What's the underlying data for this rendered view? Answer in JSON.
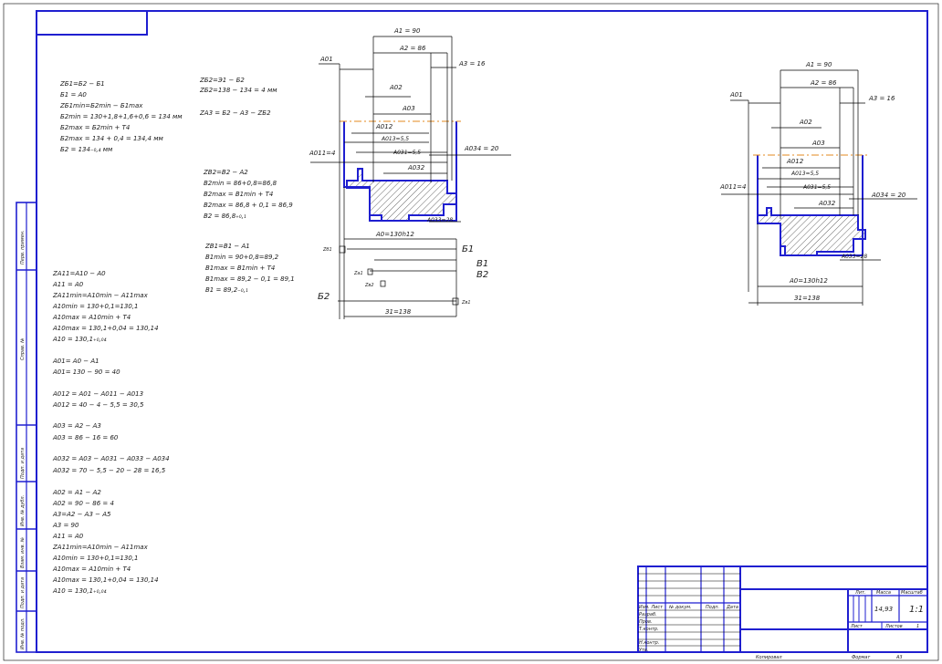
{
  "sheet": {
    "format_label": "Формат",
    "format_value": "A3",
    "copied_label": "Копировал"
  },
  "calc_left": [
    "ZБ1=Б2 − Б1",
    "Б1 = А0",
    "ZБ1min=Б2min − Б1max",
    "Б2min = 130+1,8+1,6+0,6 = 134 мм",
    "Б2max = Б2min + T4",
    "Б2max = 134 + 0,4 = 134,4 мм",
    "Б2 = 134₋₀,₄ мм"
  ],
  "calc_mid1": [
    "ZБ2=Э1 − Б2",
    "ZБ2=138 − 134 = 4 мм"
  ],
  "calc_mid2": [
    "ZА3 = Б2 − А3 − ZБ2"
  ],
  "calc_mid3": [
    "ZВ2=В2 − А2",
    "В2min = 86+0,8=86,8",
    "В2max = В1min + T4",
    "В2max = 86,8 + 0,1 = 86,9",
    "В2 = 86,8₊₀,₁"
  ],
  "calc_mid4": [
    "ZВ1=В1 − А1",
    "В1min = 90+0,8=89,2",
    "В1max = В1min + T4",
    "В1max = 89,2 − 0,1 = 89,1",
    "В1 = 89,2₋₀,₁"
  ],
  "calc_a": [
    "ZА11=А10 − А0",
    "А11 = А0",
    "ZА11min=А10min − А11max",
    "А10min = 130+0,1=130,1",
    "А10max = А10min + T4",
    "А10max = 130,1+0,04 = 130,14",
    "А10 = 130,1₊₀,₀₄"
  ],
  "calc_b": [
    "А01= А0 − А1",
    "А01= 130 − 90 = 40"
  ],
  "calc_c": [
    "А012 = А01 − А011 − А013",
    "А012 = 40 − 4 − 5,5 = 30,5"
  ],
  "calc_d": [
    "А03 = А2 − А3",
    "А03 = 86 − 16 = 60"
  ],
  "calc_e": [
    "А032 = А03 − А031 − А033 − А034",
    "А032 = 70 − 5,5 − 20 − 28 = 16,5"
  ],
  "calc_f": [
    "А02 = А1 − А2",
    "А02 = 90 − 86 = 4",
    "А3=А2 − А3 − А5",
    "А3 = 90",
    "А11 = А0",
    "ZА11min=А10min − А11max",
    "А10min = 130+0,1=130,1",
    "А10max = А10min + T4",
    "А10max = 130,1+0,04 = 130,14",
    "А10 = 130,1₊₀,₀₄"
  ],
  "drawing1": {
    "dims": {
      "a1": "А1 = 90",
      "a2": "А2 = 86",
      "a3": "А3 = 16",
      "a01": "А01",
      "a02": "А02",
      "a03": "А03",
      "a012": "А012",
      "a013": "А013=5,5",
      "a031": "А031=5,5",
      "a011": "А011=4",
      "a034": "А034 = 20",
      "a032": "А032",
      "a033": "А033=28",
      "a0": "А0=130h12",
      "b1": "Б1",
      "b2": "Б2",
      "v1": "В1",
      "v2": "В2",
      "zb1": "Zб1",
      "za1": "Zа1",
      "zv2": "Zв2",
      "zv1": "Zв1",
      "e1": "З1=138"
    }
  },
  "drawing2": {
    "dims": {
      "a1": "А1 = 90",
      "a2": "А2 = 86",
      "a3": "А3 = 16",
      "a01": "А01",
      "a02": "А02",
      "a03": "А03",
      "a012": "А012",
      "a013": "А013=5,5",
      "a031": "А031=5,5",
      "a011": "А011=4",
      "a034": "А034 = 20",
      "a032": "А032",
      "a033": "А033=28",
      "a0": "А0=130h12",
      "e1": "З1=138"
    }
  },
  "left_strip": [
    "Перв. примен.",
    "Справ. №",
    "Подп. и дата",
    "Инв. № дубл.",
    "Взам. инв. №",
    "Подп. и дата",
    "Инв. № подл."
  ],
  "title_block": {
    "row_labels": [
      "Изм. Лист",
      "Разраб.",
      "Пров.",
      "Т.контр.",
      "",
      "Н.контр.",
      "Утв."
    ],
    "col_labels": [
      "№ докум.",
      "Подп.",
      "Дата"
    ],
    "lit_label": "Лит.",
    "mass_label": "Масса",
    "scale_label": "Масштаб",
    "mass_value": "14,93",
    "scale_value": "1:1",
    "sheet_label": "Лист",
    "sheets_label": "Листов",
    "sheets_value": "1"
  }
}
